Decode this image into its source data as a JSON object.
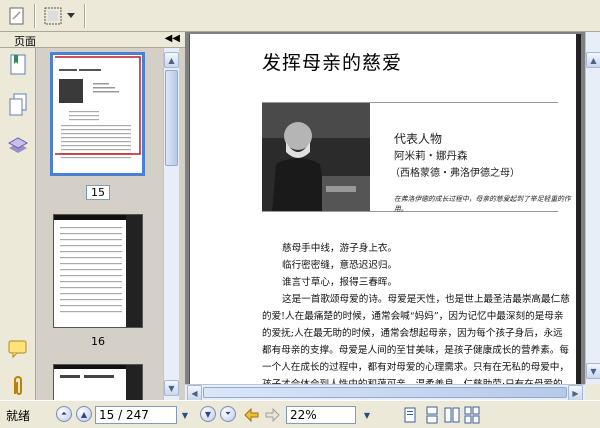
{
  "toolbar": {
    "buttons": [
      {
        "name": "select-tool-icon"
      },
      {
        "name": "snapshot-tool-icon"
      },
      {
        "name": "dropdown-arrow-icon"
      }
    ]
  },
  "left_panel": {
    "title": "页面",
    "collapse_glyph": "◀◀",
    "thumbnails": [
      {
        "label": "15",
        "selected": true
      },
      {
        "label": "16",
        "selected": false
      }
    ]
  },
  "document": {
    "title": "发挥母亲的慈爱",
    "representative_label": "代表人物",
    "representative_name": "阿米莉・娜丹森",
    "representative_note": "（西格蒙德・弗洛伊德之母）",
    "caption": "在弗洛伊德的成长过程中，母亲的慈爱起到了举足轻重的作用。",
    "poem": [
      "慈母手中线，游子身上衣。",
      "临行密密缝，意恐迟迟归。",
      "谁言寸草心，报得三春晖。"
    ],
    "paragraphs": [
      "这是一首歌颂母爱的诗。母爱是天性，也是世上最圣洁最崇高最仁慈的爱!人在最痛楚的时候，通常会喊“妈妈”，因为记忆中最深刻的是母亲的爱抚;人在最无助的时候，通常会想起母亲，因为每个孩子身后，永远都有母亲的支撑。母爱是人间的至甘美味，是孩子健康成长的营养素。每一个人在成长的过程中，都有对母爱的心理需求。只有在无私的母爱中，孩子才会体会到人性中的和蔼可亲、温柔善良、仁慈助劳;只有在母爱的呵护下，孩子才会感受到家庭的和睦安详。如果孩子长期得"
    ]
  },
  "statusbar": {
    "status": "就绪",
    "page_field": "15 / 247",
    "zoom_field": "22%"
  },
  "colors": {
    "chrome": "#ece9d8",
    "selected_thumb_border": "#4a7fd4",
    "scrollbar": "#e8eef8"
  }
}
